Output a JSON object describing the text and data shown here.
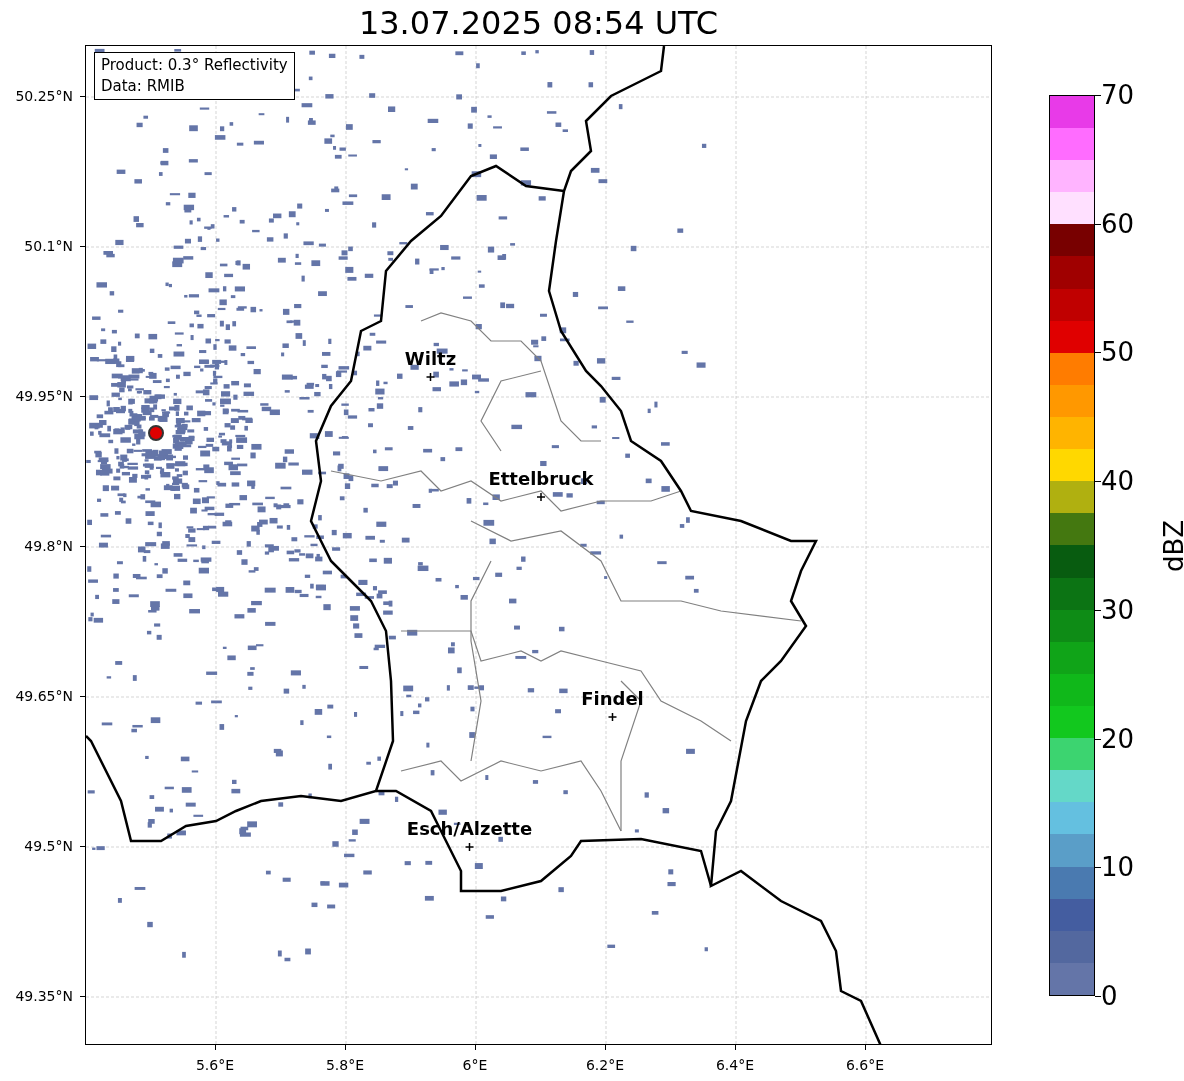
{
  "title": "13.07.2025 08:54 UTC",
  "legend": [
    "Product: 0.3° Reflectivity",
    "Data: RMIB"
  ],
  "y_ticks": [
    {
      "label": "50.25°N"
    },
    {
      "label": "50.1°N"
    },
    {
      "label": "49.95°N"
    },
    {
      "label": "49.8°N"
    },
    {
      "label": "49.65°N"
    },
    {
      "label": "49.5°N"
    },
    {
      "label": "49.35°N"
    }
  ],
  "x_ticks": [
    {
      "label": "5.6°E"
    },
    {
      "label": "5.8°E"
    },
    {
      "label": "6°E"
    },
    {
      "label": "6.2°E"
    },
    {
      "label": "6.4°E"
    },
    {
      "label": "6.6°E"
    }
  ],
  "cities": [
    {
      "name": "Wiltz"
    },
    {
      "name": "Ettelbruck"
    },
    {
      "name": "Findel"
    },
    {
      "name": "Esch/Alzette"
    }
  ],
  "colorbar": {
    "label": "dBZ",
    "ticks": [
      "70",
      "60",
      "50",
      "40",
      "30",
      "20",
      "10",
      "0"
    ],
    "bands": [
      {
        "color": "#6475a8"
      },
      {
        "color": "#53689f"
      },
      {
        "color": "#445da0"
      },
      {
        "color": "#4a7ab0"
      },
      {
        "color": "#5a9ec8"
      },
      {
        "color": "#64c0e0"
      },
      {
        "color": "#64d8c8"
      },
      {
        "color": "#3cd470"
      },
      {
        "color": "#12c81e"
      },
      {
        "color": "#10b81a"
      },
      {
        "color": "#10a418"
      },
      {
        "color": "#0e8c16"
      },
      {
        "color": "#0c7414"
      },
      {
        "color": "#085c10"
      },
      {
        "color": "#447810"
      },
      {
        "color": "#b0b010"
      },
      {
        "color": "#ffd800"
      },
      {
        "color": "#ffb400"
      },
      {
        "color": "#ff9800"
      },
      {
        "color": "#ff7c00"
      },
      {
        "color": "#e00000"
      },
      {
        "color": "#c00000"
      },
      {
        "color": "#a00000"
      },
      {
        "color": "#780000"
      },
      {
        "color": "#ffe0ff"
      },
      {
        "color": "#ffb4ff"
      },
      {
        "color": "#ff6cff"
      },
      {
        "color": "#e83ae8"
      }
    ]
  }
}
